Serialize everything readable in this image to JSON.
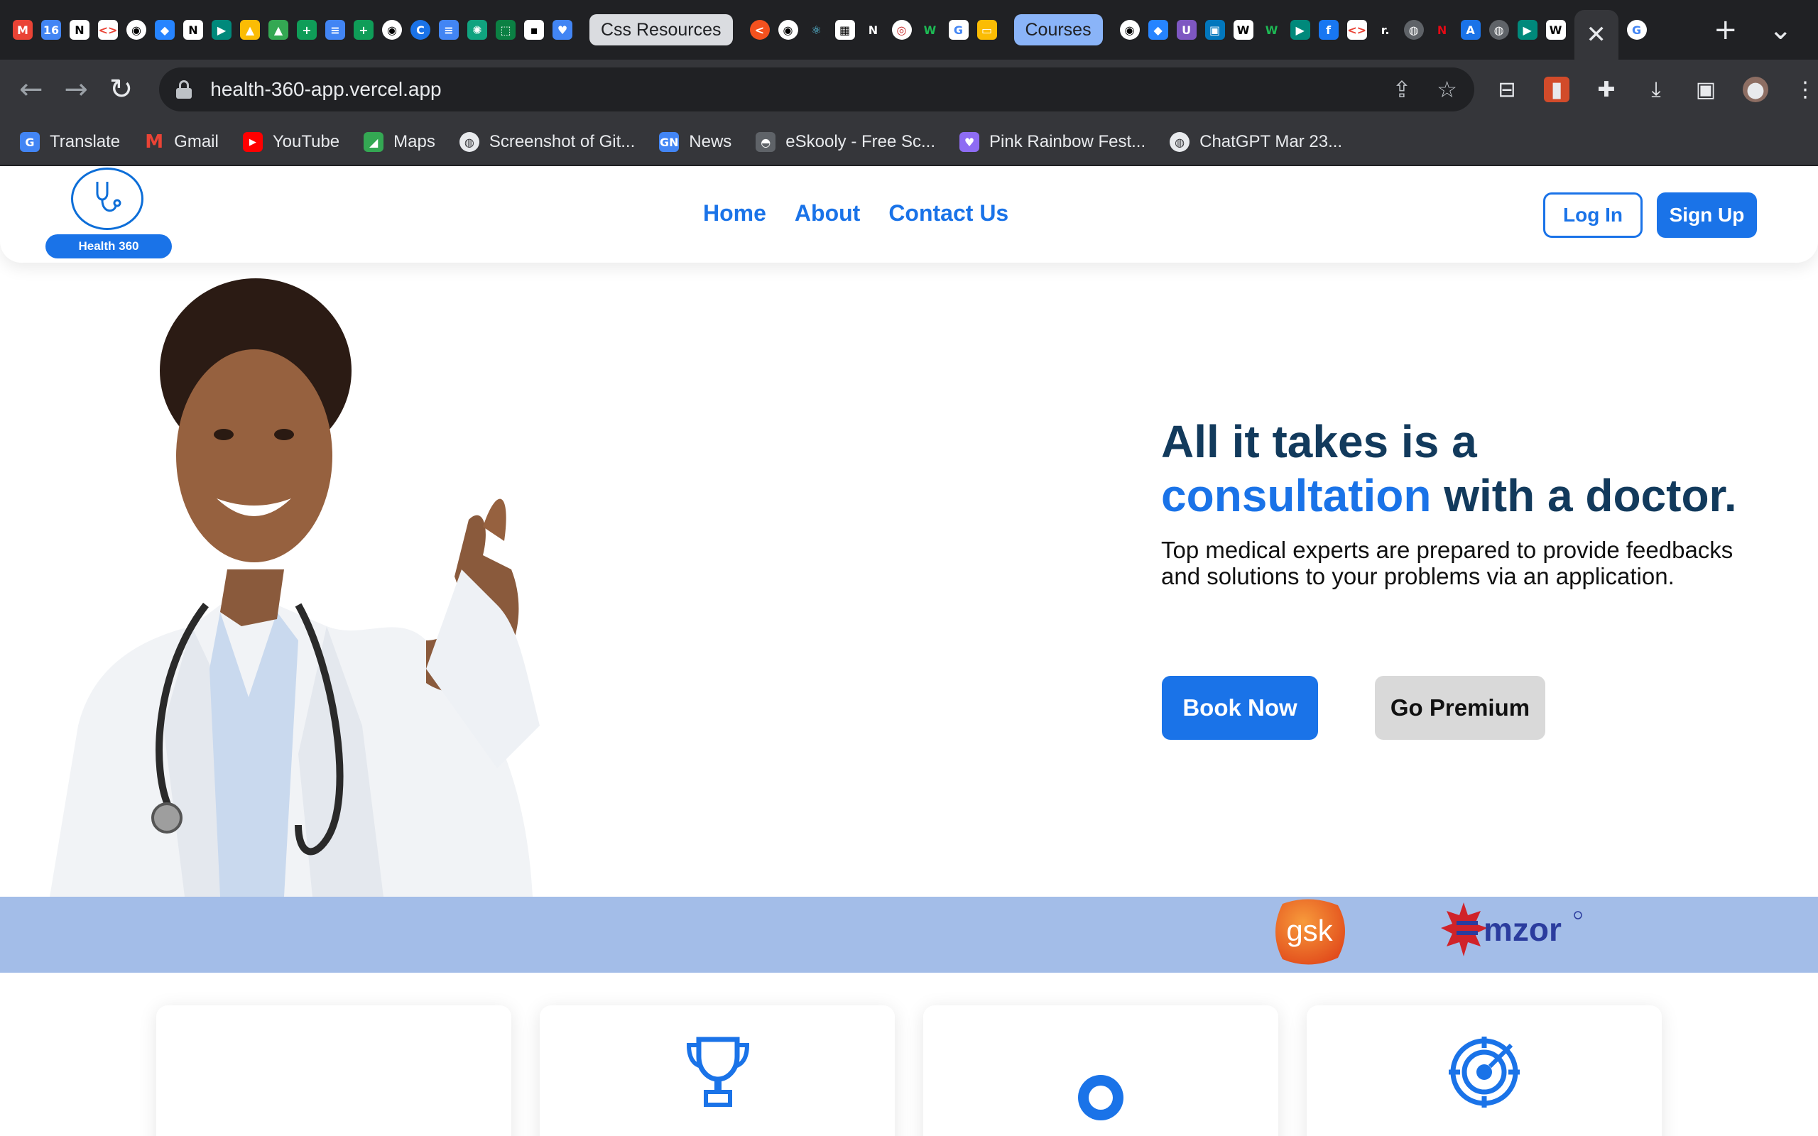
{
  "browser": {
    "tab_groups": [
      "Css Resources",
      "Courses"
    ],
    "active_tab_close": "✕",
    "new_tab": "+",
    "tab_menu": "⌄",
    "url": "health-360-app.vercel.app",
    "bookmarks": [
      {
        "label": "Translate",
        "icon": "google-translate-icon",
        "color": "#4285f4"
      },
      {
        "label": "Gmail",
        "icon": "gmail-icon",
        "color": "#ea4335"
      },
      {
        "label": "YouTube",
        "icon": "youtube-icon",
        "color": "#ff0000"
      },
      {
        "label": "Maps",
        "icon": "maps-icon",
        "color": "#34a853"
      },
      {
        "label": "Screenshot of Git...",
        "icon": "globe-icon",
        "color": "#5f6368"
      },
      {
        "label": "News",
        "icon": "news-icon",
        "color": "#4285f4"
      },
      {
        "label": "eSkooly - Free Sc...",
        "icon": "eskooly-icon",
        "color": "#5f6368"
      },
      {
        "label": "Pink Rainbow Fest...",
        "icon": "heart-icon",
        "color": "#8e6cf3"
      },
      {
        "label": "ChatGPT Mar 23...",
        "icon": "globe-icon",
        "color": "#5f6368"
      }
    ]
  },
  "site": {
    "logo_label": "Health 360",
    "nav": [
      "Home",
      "About",
      "Contact Us"
    ],
    "login": "Log In",
    "signup": "Sign Up",
    "hero": {
      "title_line1": "All it takes is a",
      "title_accent": "consultation",
      "title_rest": " with a doctor.",
      "subtitle": "Top medical experts are prepared to provide feedbacks and solutions to your problems via an application.",
      "book_button": "Book Now",
      "premium_button": "Go Premium"
    },
    "partners": [
      "gsk",
      "mzor"
    ],
    "features_icons": [
      "blank",
      "trophy-icon",
      "award-ribbon-icon",
      "target-icon"
    ]
  },
  "colors": {
    "brand_blue": "#1a73e8",
    "title_navy": "#123a5c",
    "partner_band": "#a3bde8"
  }
}
